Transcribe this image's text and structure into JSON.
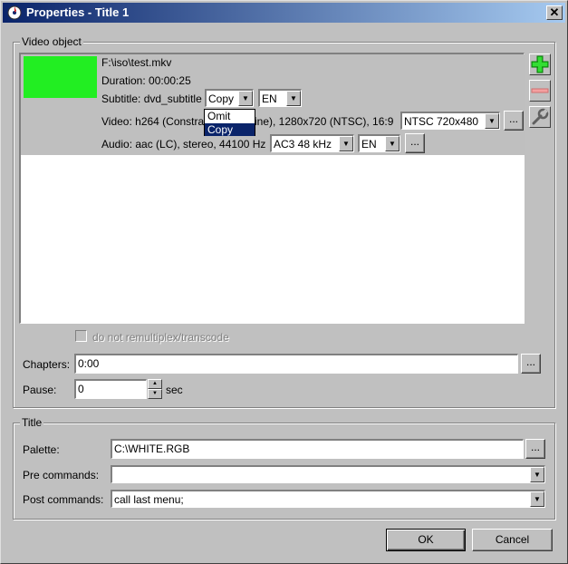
{
  "window": {
    "title": "Properties - Title 1",
    "close_glyph": "✕"
  },
  "video_object": {
    "group_label": "Video object",
    "item": {
      "thumbnail_color": "#22ee22",
      "file": "F:\\iso\\test.mkv",
      "duration": "Duration: 00:00:25",
      "subtitle_label": "Subtitle: dvd_subtitle",
      "subtitle_mode": "Copy",
      "subtitle_lang": "EN",
      "video_label_a": "Video: h264 (Constra",
      "video_label_b": "ine), 1280x720 (NTSC), 16:9",
      "video_format": "NTSC 720x480",
      "audio_label": "Audio: aac (LC), stereo, 44100 Hz",
      "audio_format": "AC3 48 kHz",
      "audio_lang": "EN"
    },
    "subtitle_dropdown": {
      "options": [
        "Omit",
        "Copy"
      ],
      "selected": "Copy"
    },
    "dots": "...",
    "no_remux_label": "do not remultiplex/transcode",
    "chapters_label": "Chapters:",
    "chapters_value": "0:00",
    "pause_label": "Pause:",
    "pause_value": "0",
    "pause_unit": "sec"
  },
  "title_group": {
    "group_label": "Title",
    "palette_label": "Palette:",
    "palette_value": "C:\\WHITE.RGB",
    "pre_label": "Pre commands:",
    "pre_value": "",
    "post_label": "Post commands:",
    "post_value": "call last menu;"
  },
  "buttons": {
    "ok": "OK",
    "cancel": "Cancel"
  },
  "icons": {
    "add": "plus-icon",
    "remove": "minus-icon",
    "settings": "wrench-icon"
  }
}
